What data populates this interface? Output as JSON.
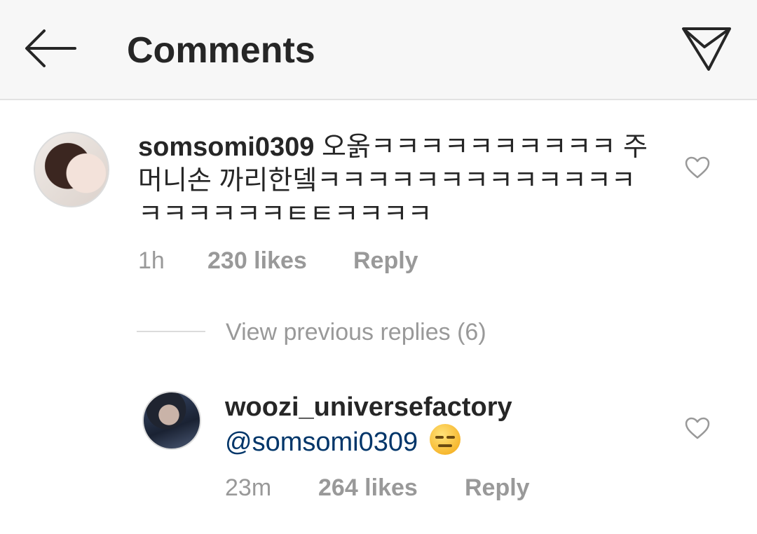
{
  "header": {
    "title": "Comments",
    "back_icon": "arrow-left-icon",
    "share_icon": "paper-plane-icon"
  },
  "comments": [
    {
      "username": "somsomi0309",
      "text": "오옭ㅋㅋㅋㅋㅋㅋㅋㅋㅋㅋ 주머니손 까리한뎈ㅋㅋㅋㅋㅋㅋㅋㅋㅋㅋㅋㅋㅋㅋㅋㅋㅋㅋㅋㅌㅌㅋㅋㅋㅋ",
      "time": "1h",
      "likes": "230 likes",
      "reply": "Reply"
    }
  ],
  "view_previous_replies": "View previous replies (6)",
  "replies": [
    {
      "username": "woozi_universefactory",
      "mention": "@somsomi0309",
      "emoji": "expressionless-face",
      "time": "23m",
      "likes": "264 likes",
      "reply": "Reply"
    }
  ],
  "colors": {
    "header_bg": "#f7f7f7",
    "text": "#262626",
    "meta": "#999999",
    "mention": "#003569"
  }
}
